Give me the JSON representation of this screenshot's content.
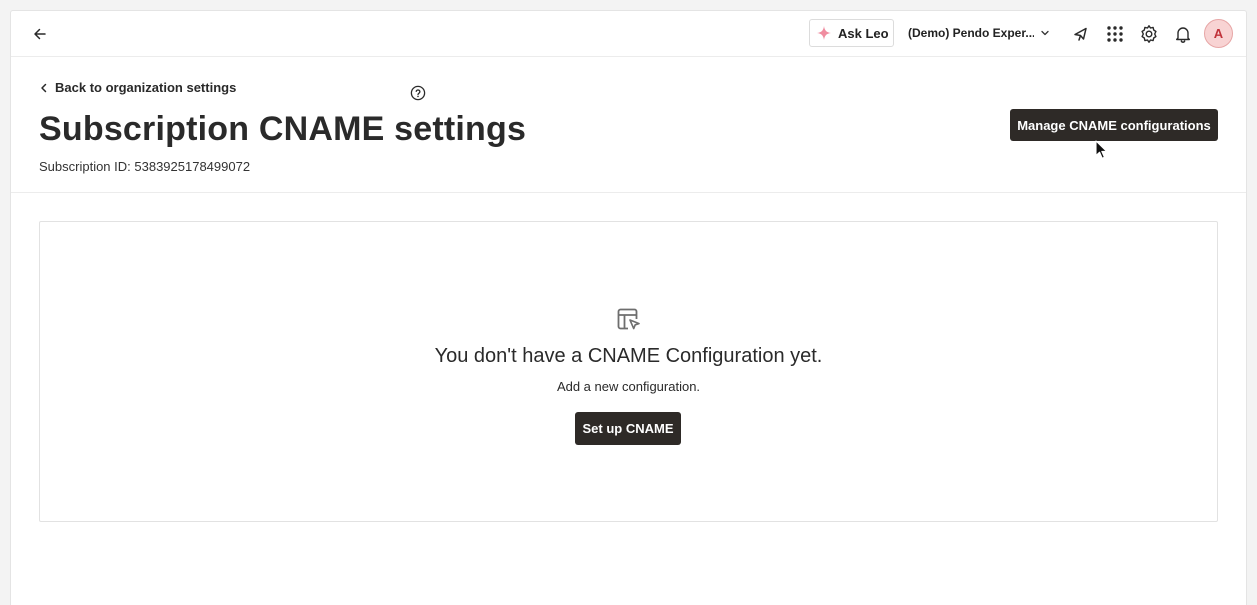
{
  "topbar": {
    "ask_leo_label": "Ask Leo",
    "org_selector_label": "(Demo) Pendo Exper...",
    "avatar_initial": "A",
    "icons": [
      "back-arrow-icon",
      "sparkle-icon",
      "chevron-down-icon",
      "announcement-icon",
      "apps-grid-icon",
      "gear-icon",
      "bell-icon"
    ],
    "accent_color": "#f08da0"
  },
  "header": {
    "breadcrumb_label": "Back to organization settings",
    "title": "Subscription CNAME settings",
    "subscription_id": "Subscription ID: 5383925178499072",
    "manage_button_label": "Manage CNAME configurations"
  },
  "empty_state": {
    "title": "You don't have a CNAME Configuration yet.",
    "subtitle": "Add a new configuration.",
    "button_label": "Set up CNAME",
    "icon": "layout-cursor-icon"
  },
  "colors": {
    "primary_button": "#2e2a27",
    "avatar_bg": "#f8d3d3",
    "avatar_text": "#c0323a"
  }
}
